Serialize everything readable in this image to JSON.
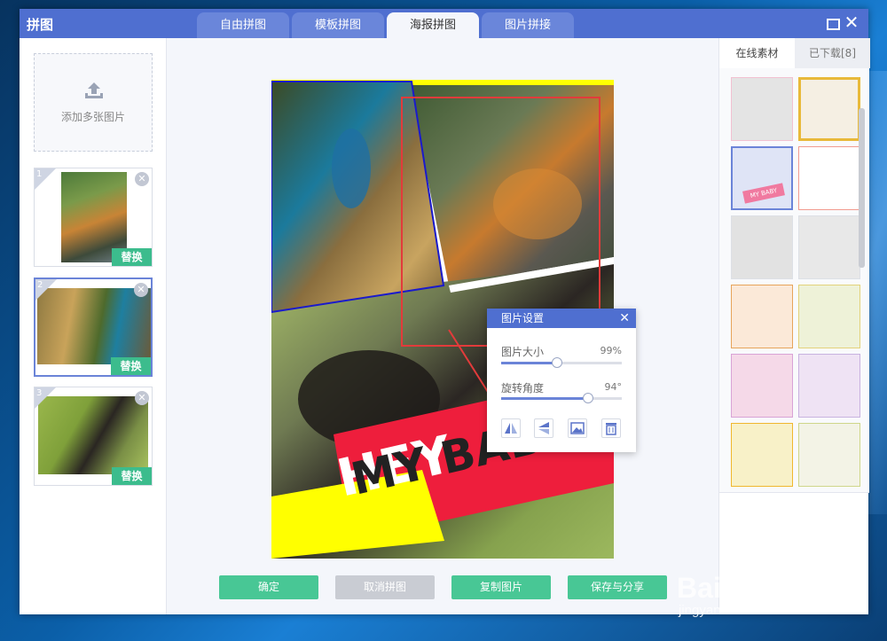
{
  "app": {
    "title": "拼图"
  },
  "tabs": [
    {
      "label": "自由拼图"
    },
    {
      "label": "模板拼图"
    },
    {
      "label": "海报拼图"
    },
    {
      "label": "图片拼接"
    }
  ],
  "left": {
    "add_label": "添加多张图片",
    "thumbs": [
      {
        "num": "1",
        "replace": "替换"
      },
      {
        "num": "2",
        "replace": "替换"
      },
      {
        "num": "3",
        "replace": "替换"
      }
    ]
  },
  "poster": {
    "text_hey": "HEY",
    "text_mybaby": "MY BABY"
  },
  "popup": {
    "title": "图片设置",
    "size_label": "图片大小",
    "size_value": "99%",
    "size_fraction": 0.46,
    "rotate_label": "旋转角度",
    "rotate_value": "94°",
    "rotate_fraction": 0.72
  },
  "actions": {
    "confirm": "确定",
    "cancel": "取消拼图",
    "copy": "复制图片",
    "save": "保存与分享"
  },
  "right": {
    "tab_online": "在线素材",
    "tab_downloaded": "已下载[8]",
    "template_baby_text": "MY BABY"
  },
  "watermark": {
    "brand": "Bai du 经验",
    "url": "jingyan.baidu.com"
  }
}
